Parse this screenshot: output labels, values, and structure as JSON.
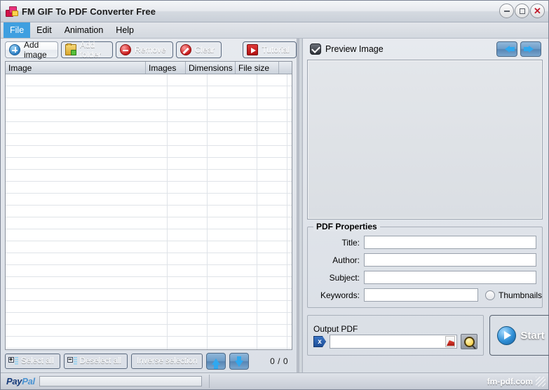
{
  "window": {
    "title": "FM GIF To PDF Converter Free",
    "icon": "app-icon",
    "buttons": {
      "minimize": "minimize",
      "maximize": "maximize",
      "close": "close"
    }
  },
  "menubar": {
    "items": [
      {
        "label": "File",
        "active": true
      },
      {
        "label": "Edit",
        "active": false
      },
      {
        "label": "Animation",
        "active": false
      },
      {
        "label": "Help",
        "active": false
      }
    ]
  },
  "toolbar": {
    "buttons": [
      {
        "label": "Add image",
        "icon": "plus-circle-icon",
        "style": "light"
      },
      {
        "label": "Add folder",
        "icon": "folder-add-icon",
        "style": "dark"
      },
      {
        "label": "Remove",
        "icon": "minus-circle-icon",
        "style": "dark"
      },
      {
        "label": "Clear",
        "icon": "no-entry-icon",
        "style": "dark"
      },
      {
        "label": "Tutorial",
        "icon": "play-video-icon",
        "style": "dark"
      }
    ]
  },
  "file_list": {
    "columns": [
      {
        "label": "Image"
      },
      {
        "label": "Images"
      },
      {
        "label": "Dimensions"
      },
      {
        "label": "File size"
      }
    ],
    "rows": []
  },
  "selection_bar": {
    "select_all": "Select all",
    "deselect_all": "Deselect all",
    "inverse_selection": "Inverse selection",
    "move_up": "move-up",
    "move_down": "move-down",
    "count": "0 / 0"
  },
  "preview": {
    "checkbox_label": "Preview Image",
    "checkbox_checked": true,
    "prev": "previous-image",
    "next": "next-image"
  },
  "pdf_properties": {
    "legend": "PDF Properties",
    "fields": [
      {
        "label": "Title:",
        "value": "",
        "placeholder": ""
      },
      {
        "label": "Author:",
        "value": "",
        "placeholder": ""
      },
      {
        "label": "Subject:",
        "value": "",
        "placeholder": ""
      },
      {
        "label": "Keywords:",
        "value": "",
        "placeholder": ""
      }
    ],
    "thumbnails_label": "Thumbnails",
    "thumbnails_checked": false
  },
  "output_pdf": {
    "legend": "Output PDF",
    "path_value": "",
    "path_placeholder": "",
    "clear_icon": "clear-path-icon",
    "pdf_icon": "pdf-file-icon",
    "browse_icon": "browse-magnifier-icon",
    "start_label": "Start"
  },
  "statusbar": {
    "paypal_part1": "Pay",
    "paypal_part2": "Pal",
    "progress_value": 0,
    "site": "fm-pdf.com"
  },
  "colors": {
    "accent_blue": "#3f9fe0",
    "button_dark": "#6c7b93",
    "close_red": "#c0182a",
    "pdf_red": "#c71c1c",
    "window_bg": "#dfe3e9"
  }
}
